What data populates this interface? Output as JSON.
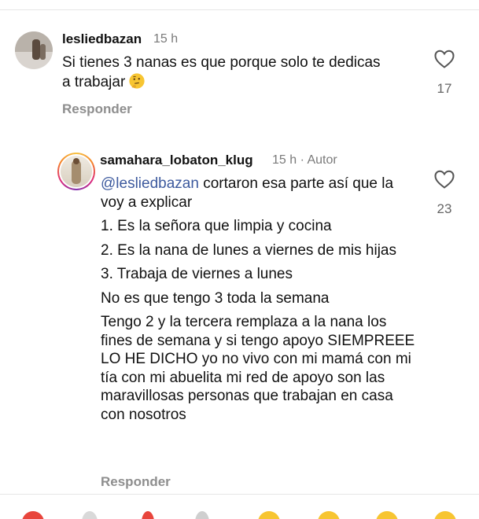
{
  "comments": [
    {
      "username": "lesliedbazan",
      "time": "15 h",
      "text": "Si tienes 3 nanas es que porque solo te dedicas a trabajar",
      "emoji": "thinking-face",
      "likes": "17",
      "reply_label": "Responder"
    },
    {
      "username": "samahara_lobaton_klug",
      "time": "15 h",
      "author_tag": "· Autor",
      "mention": "@lesliedbazan",
      "text_intro": " cortaron esa parte así que la voy a explicar",
      "line_1": "1. Es la señora que limpia y cocina",
      "line_2": "2. Es la nana de lunes a viernes de mis hijas",
      "line_3": "3. Trabaja de viernes a lunes",
      "line_4": "No es que tengo 3 toda la semana",
      "line_5": "Tengo 2 y la tercera remplaza a la nana los fines de semana y si tengo apoyo SIEMPREEE LO HE DICHO yo no vivo con mi mamá con mi tía con mi abuelita mi red de apoyo son las maravillosas personas que trabajan en casa con nosotros",
      "likes": "23",
      "reply_label": "Responder"
    }
  ],
  "colors": {
    "mention": "#3d5a9e",
    "muted": "#8e8e8e",
    "story_ring": [
      "#f6c343",
      "#f58529",
      "#dd2a7b",
      "#8134af"
    ]
  },
  "icons": [
    "heart-outline-icon",
    "thinking-face-emoji"
  ]
}
